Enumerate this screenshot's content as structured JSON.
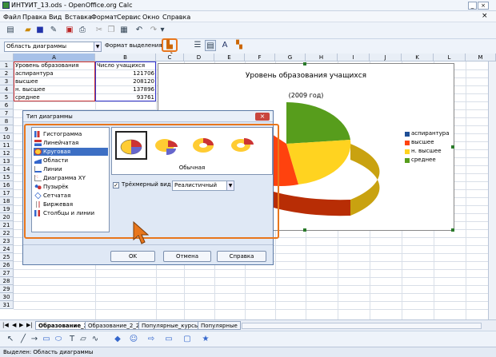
{
  "window": {
    "title": "ИНТУИТ_13.ods - OpenOffice.org Calc",
    "btn_min": "_",
    "btn_max": "□",
    "btn_close": "×"
  },
  "menu": [
    "Файл",
    "Правка",
    "Вид",
    "Вставка",
    "Формат",
    "Сервис",
    "Окно",
    "Справка"
  ],
  "toolbar2": {
    "area_combo": "Область диаграммы",
    "format_selection": "Формат выделения"
  },
  "columns": [
    "A",
    "B",
    "C",
    "D",
    "E",
    "F",
    "G",
    "H",
    "I",
    "J",
    "K",
    "L",
    "M"
  ],
  "rows": [
    "1",
    "2",
    "3",
    "4",
    "5",
    "6",
    "7",
    "8",
    "9",
    "10",
    "11",
    "12",
    "13",
    "14",
    "15",
    "16",
    "17",
    "18",
    "19",
    "20",
    "21",
    "22",
    "23",
    "24",
    "25",
    "26",
    "27",
    "28",
    "29",
    "30",
    "31"
  ],
  "cells": {
    "a1": "Уровень образования",
    "b1": "Число учащихся",
    "a2": "аспирантура",
    "b2": "121706",
    "a3": "высшее",
    "b3": "208120",
    "a4": "н. высшее",
    "b4": "137896",
    "a5": "среднее",
    "b5": "93761"
  },
  "chart": {
    "title": "Уровень образования учащихся",
    "subtitle": "(2009 год)",
    "legend": [
      {
        "label": "аспирантура",
        "color": "#1f4e96"
      },
      {
        "label": "высшее",
        "color": "#ff420e"
      },
      {
        "label": "н. высшее",
        "color": "#ffd320"
      },
      {
        "label": "среднее",
        "color": "#579d1c"
      }
    ]
  },
  "dialog": {
    "title": "Тип диаграммы",
    "types": [
      "Гистограмма",
      "Линейчатая",
      "Круговая",
      "Области",
      "Линии",
      "Диаграмма XY",
      "Пузырёк",
      "Сетчатая",
      "Биржевая",
      "Столбцы и линии"
    ],
    "selected_type": "Круговая",
    "variant_label": "Обычная",
    "three_d_label": "Трёхмерный вид",
    "three_d_checked": "✓",
    "render_style": "Реалистичный",
    "ok": "OK",
    "cancel": "Отмена",
    "help": "Справка"
  },
  "sheet_tabs": [
    "Образование_2",
    "Образование_2_2",
    "Популярные_курсы",
    "Популярные"
  ],
  "status": "Выделен: Область диаграммы"
}
